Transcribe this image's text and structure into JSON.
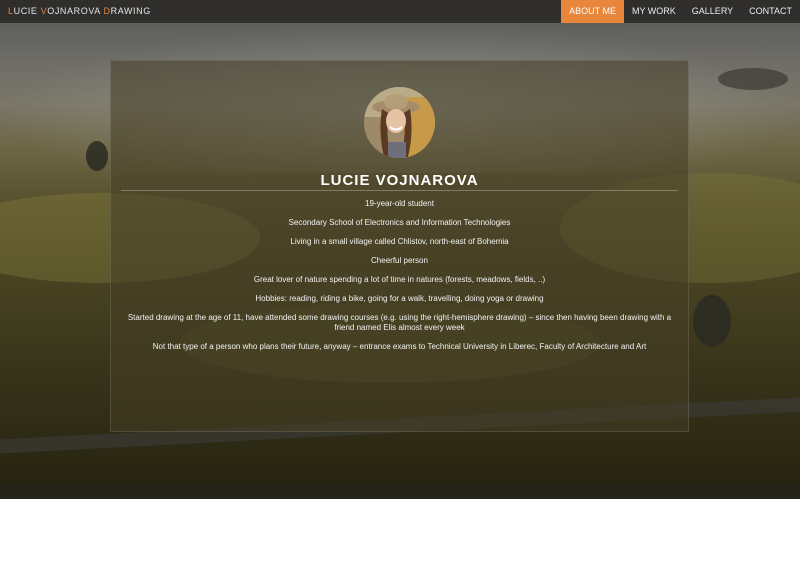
{
  "brand": {
    "parts": [
      {
        "text": "L",
        "accent": true
      },
      {
        "text": "UCIE ",
        "accent": false
      },
      {
        "text": "V",
        "accent": true
      },
      {
        "text": "OJNAROVA ",
        "accent": false
      },
      {
        "text": "D",
        "accent": true
      },
      {
        "text": "RAWING",
        "accent": false
      }
    ]
  },
  "nav": {
    "items": [
      {
        "label": "ABOUT ME",
        "active": true
      },
      {
        "label": "MY WORK",
        "active": false
      },
      {
        "label": "GALLERY",
        "active": false
      },
      {
        "label": "CONTACT",
        "active": false
      }
    ]
  },
  "colors": {
    "accent": "#e8863b",
    "navbar": "#2f2e2c"
  },
  "profile": {
    "name": "LUCIE VOJNAROVA",
    "facts": [
      "19-year-old student",
      "Secondary School of Electronics and Information Technologies",
      "Living in a small village called Chlistov, north-east of Bohemia",
      "Cheerful person",
      "Great lover of nature spending a lot of time in natures (forests, meadows, fields, ..)",
      "Hobbies: reading, riding a bike, going for a walk, travelling, doing yoga or drawing",
      "Started drawing at the age of 11, have attended some drawing courses (e.g. using the right-hemisphere drawing) – since then having been drawing with a friend named Elis almost every week",
      "Not that type of a person who plans their future, anyway – entrance exams to Technical University in Liberec, Faculty of Architecture and Art"
    ]
  }
}
